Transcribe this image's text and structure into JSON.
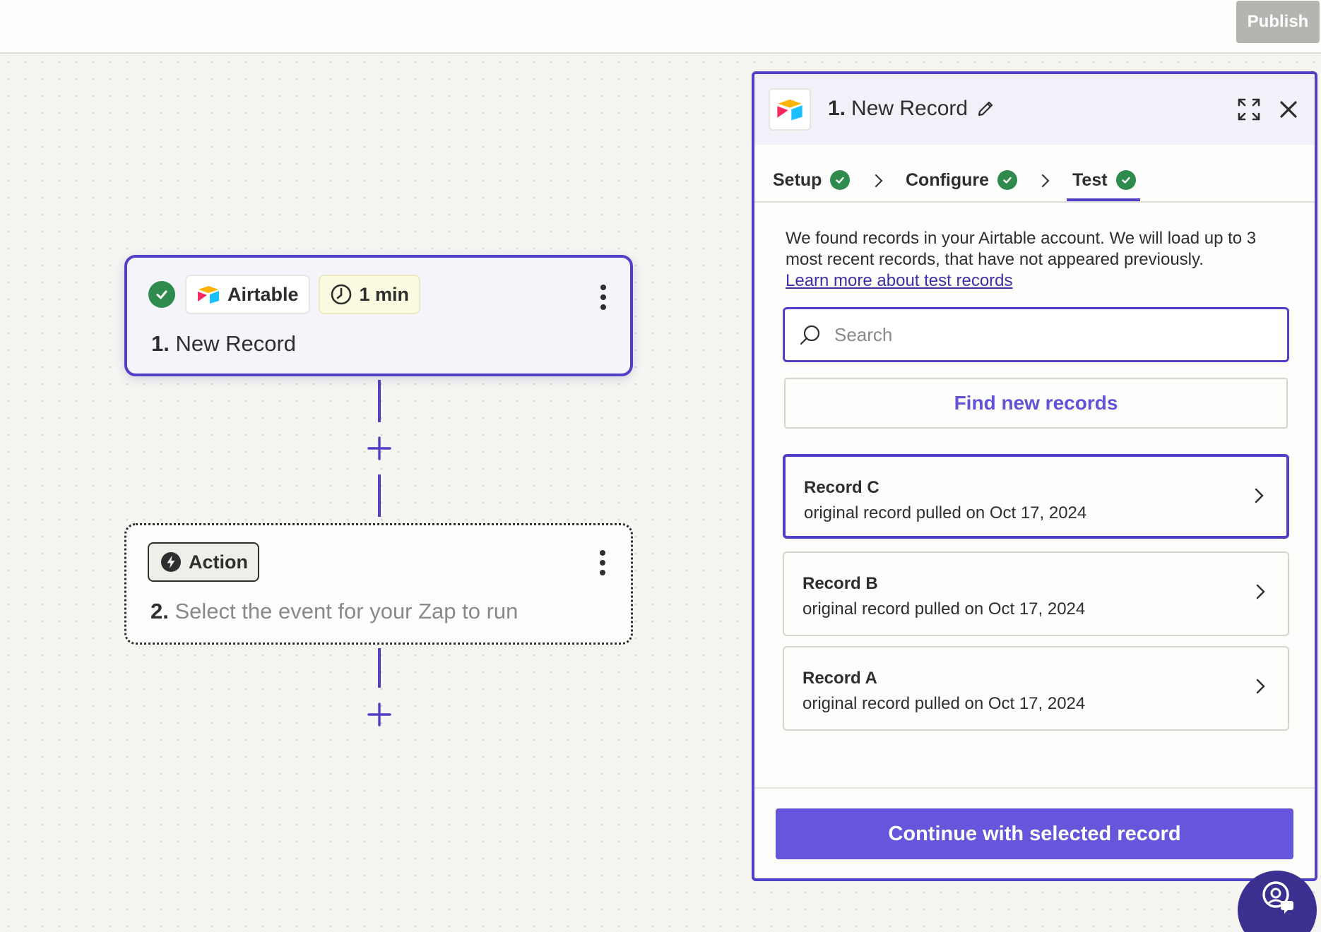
{
  "topbar": {
    "publish_label": "Publish"
  },
  "trigger_card": {
    "app_name": "Airtable",
    "time_label": "1 min",
    "step_number": "1.",
    "step_title": "New Record"
  },
  "action_card": {
    "chip_label": "Action",
    "step_number": "2.",
    "step_title": "Select the event for your Zap to run"
  },
  "panel": {
    "step_number": "1.",
    "title": "New Record",
    "tabs": [
      {
        "label": "Setup",
        "status": "complete"
      },
      {
        "label": "Configure",
        "status": "complete"
      },
      {
        "label": "Test",
        "status": "complete",
        "active": true
      }
    ],
    "info_text": "We found records in your Airtable account. We will load up to 3 most recent records, that have not appeared previously.",
    "info_link": "Learn more about test records",
    "search_placeholder": "Search",
    "find_button": "Find new records",
    "records": [
      {
        "name": "Record C",
        "meta": "original record pulled on Oct 17, 2024",
        "selected": true
      },
      {
        "name": "Record B",
        "meta": "original record pulled on Oct 17, 2024",
        "selected": false
      },
      {
        "name": "Record A",
        "meta": "original record pulled on Oct 17, 2024",
        "selected": false
      }
    ],
    "continue_button": "Continue with selected record"
  },
  "icons": {
    "app_logo": "airtable-logo",
    "check": "check-circle-icon",
    "clock": "clock-icon",
    "bolt": "bolt-icon",
    "kebab": "kebab-menu-icon",
    "plus": "plus-icon",
    "pencil": "pencil-icon",
    "expand": "expand-icon",
    "close": "close-icon",
    "chevron": "chevron-right-icon",
    "search": "search-icon",
    "help": "help-icon"
  },
  "colors": {
    "accent": "#503fc7",
    "primary_button": "#6656dc",
    "success": "#2f8a4d",
    "link": "#3d2fa8",
    "publish_disabled": "#b5b4b1"
  }
}
